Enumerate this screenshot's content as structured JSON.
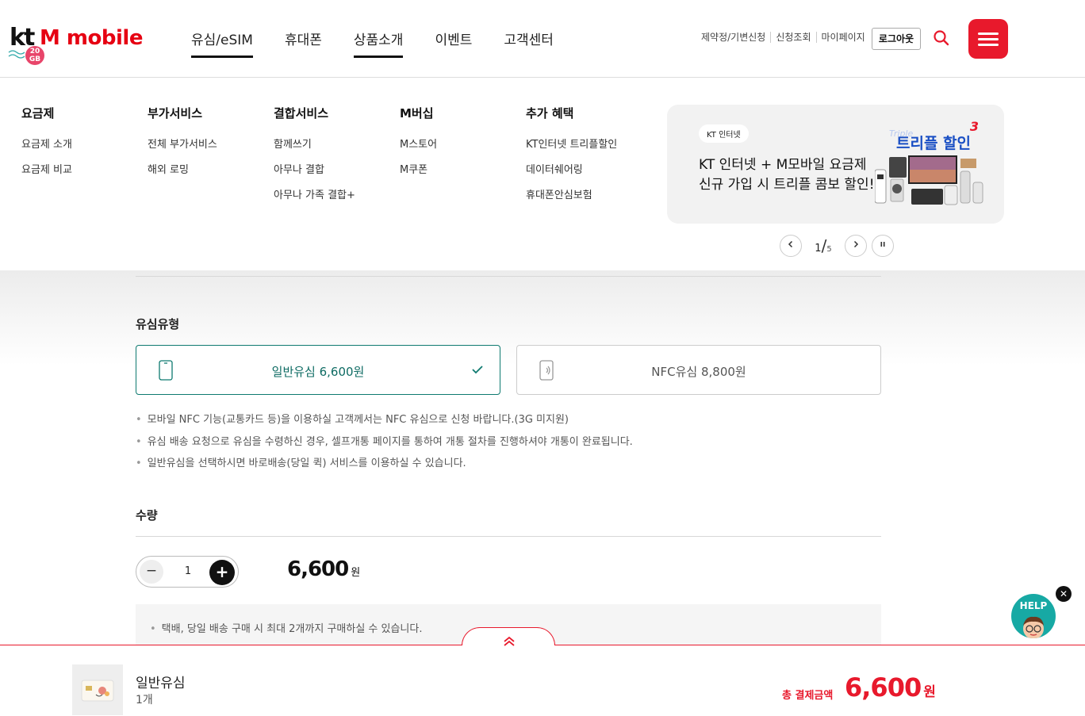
{
  "header": {
    "logo_kt": "kt",
    "logo_brand": "M mobile",
    "logo_badge": "20 GB",
    "nav": [
      "유심/eSIM",
      "휴대폰",
      "상품소개",
      "이벤트",
      "고객센터"
    ],
    "util_links": [
      "제약정/기변신청",
      "신청조회",
      "마이페이지"
    ],
    "logout": "로그아웃"
  },
  "mega_menu": {
    "columns": [
      {
        "title": "요금제",
        "items": [
          "요금제 소개",
          "요금제 비교"
        ]
      },
      {
        "title": "부가서비스",
        "items": [
          "전체 부가서비스",
          "해외 로밍"
        ]
      },
      {
        "title": "결합서비스",
        "items": [
          "함께쓰기",
          "아무나 결합",
          "아무나 가족 결합+"
        ]
      },
      {
        "title": "M버십",
        "items": [
          "M스토어",
          "M쿠폰"
        ]
      },
      {
        "title": "추가 혜택",
        "items": [
          "KT인터넷 트리플할인",
          "데이터쉐어링",
          "휴대폰안심보험"
        ]
      }
    ],
    "banner": {
      "tag": "KT 인터넷",
      "line1": "KT 인터넷 + M모바일 요금제",
      "line2": "신규 가입 시 트리플 콤보 할인!",
      "title": "트리플 할인",
      "title_num": "3",
      "deco": "Triple"
    },
    "pager": {
      "current": "1",
      "total": "5"
    }
  },
  "usim_type": {
    "title": "유심유형",
    "options": [
      {
        "label": "일반유심 6,600원",
        "selected": true
      },
      {
        "label": "NFC유심 8,800원",
        "selected": false
      }
    ],
    "notes": [
      "모바일 NFC 기능(교통카드 등)을 이용하실 고객께서는 NFC 유심으로 신청 바랍니다.(3G 미지원)",
      "유심 배송 요청으로 유심을 수령하신 경우, 셀프개통 페이지를 통하여 개통 절차를 진행하셔야 개통이 완료됩니다.",
      "일반유심을 선택하시면 바로배송(당일 퀵) 서비스를 이용하실 수 있습니다."
    ]
  },
  "quantity": {
    "title": "수량",
    "minus": "−",
    "value": "1",
    "plus": "+",
    "price": "6,600",
    "won": "원",
    "note": "택배, 당일 배송 구매 시 최대 2개까지 구매하실 수 있습니다."
  },
  "help": {
    "label": "HELP",
    "close": "✕"
  },
  "bottom_bar": {
    "product_name": "일반유심",
    "product_qty": "1개",
    "total_label": "총 결제금액",
    "total_value": "6,600",
    "won": "원"
  },
  "colors": {
    "brand_red": "#e8192c",
    "teal": "#0e7a70",
    "help": "#17a9a4"
  }
}
